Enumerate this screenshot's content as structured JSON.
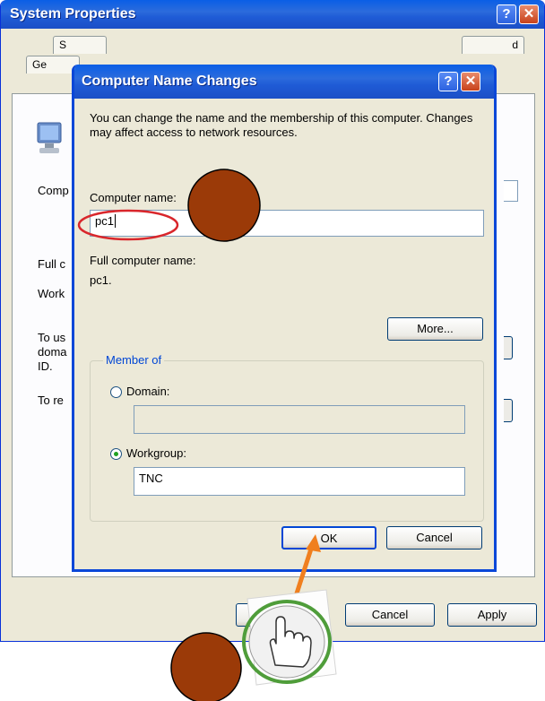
{
  "system_properties": {
    "title": "System Properties",
    "help_btn": "?",
    "close_btn": "✕",
    "tabs_row1": [
      "S",
      "d"
    ],
    "tabs_row2": [
      "Ge"
    ],
    "labels": {
      "comp": "Comp",
      "full": "Full c",
      "work": "Work",
      "to_use_1": "To us",
      "to_use_2": "doma",
      "to_use_3": "ID.",
      "to_re": "To re"
    },
    "buttons": {
      "ok": "OK",
      "cancel": "Cancel",
      "apply": "Apply"
    }
  },
  "dialog": {
    "title": "Computer Name Changes",
    "help_btn": "?",
    "close_btn": "✕",
    "description": "You can change the name and the membership of this computer. Changes may affect access to network resources.",
    "computer_name_label": "Computer name:",
    "computer_name_value": "pc1",
    "full_name_label": "Full computer name:",
    "full_name_value": "pc1.",
    "more_button": "More...",
    "member_of_legend": "Member of",
    "domain_label": "Domain:",
    "domain_value": "",
    "workgroup_label": "Workgroup:",
    "workgroup_value": "TNC",
    "selected_membership": "workgroup",
    "ok_button": "OK",
    "cancel_button": "Cancel"
  },
  "annotations": {
    "highlight_color": "#d9262b",
    "marker_color": "#9b3a08",
    "arrow_color": "#f07f1e",
    "cursor_icon": "hand-pointer-icon"
  }
}
